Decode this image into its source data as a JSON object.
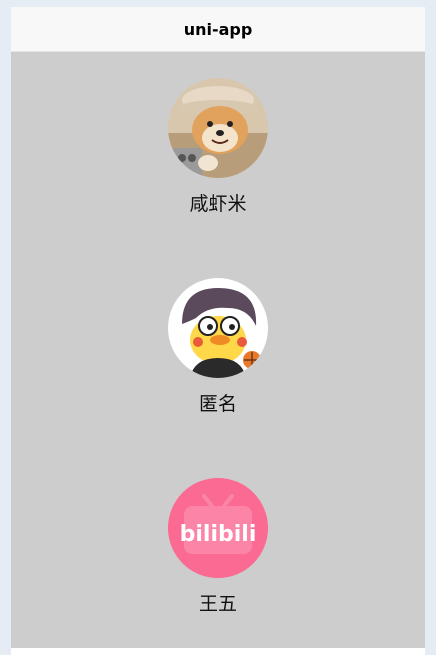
{
  "navbar": {
    "title": "uni-app"
  },
  "users": [
    {
      "name": "咸虾米",
      "avatar_icon": "shiba-dog-avatar-icon"
    },
    {
      "name": "匿名",
      "avatar_icon": "cartoon-duck-avatar-icon"
    },
    {
      "name": "王五",
      "avatar_icon": "bilibili-logo-avatar-icon"
    }
  ],
  "colors": {
    "page_bg": "#cdcdcd",
    "navbar_bg": "#f8f8f8",
    "bilibili_pink": "#fb7299"
  }
}
